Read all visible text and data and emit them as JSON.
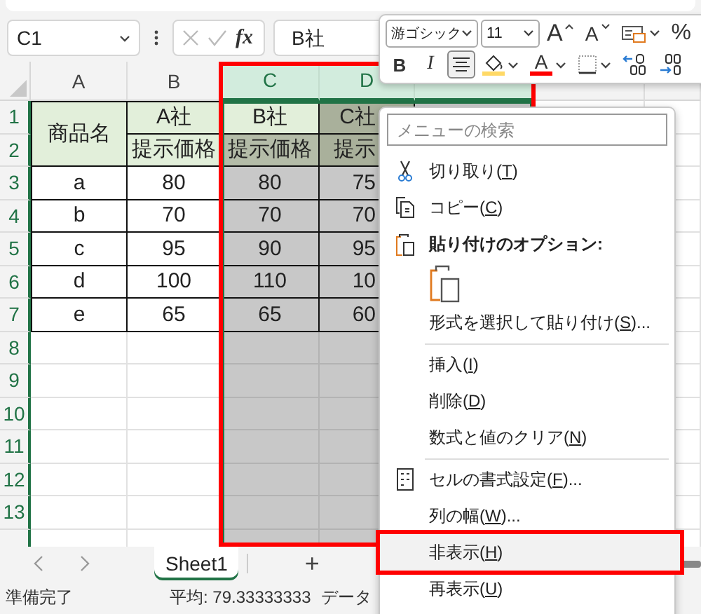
{
  "formula_bar": {
    "name_box": "C1",
    "function_label": "fx",
    "value": "B社"
  },
  "mini_toolbar": {
    "font": "游ゴシック",
    "size": "11",
    "row1": [
      {
        "kind": "grow",
        "text": "A"
      },
      {
        "kind": "shrink",
        "text": "A"
      },
      {
        "kind": "numfmt"
      },
      {
        "kind": "percent",
        "text": "%"
      }
    ],
    "row2": [
      {
        "kind": "bold",
        "text": "B",
        "selected": false
      },
      {
        "kind": "italic",
        "text": "I",
        "selected": false
      },
      {
        "kind": "align",
        "selected": true
      },
      {
        "kind": "fill",
        "color": "#ffd966"
      },
      {
        "kind": "fontcolor",
        "text": "A",
        "color": "#ff0000"
      },
      {
        "kind": "borders"
      },
      {
        "kind": "incdec"
      },
      {
        "kind": "decdec"
      }
    ]
  },
  "sheet": {
    "callout_columns": true,
    "columns": [
      {
        "label": "A",
        "selected": false
      },
      {
        "label": "B",
        "selected": false
      },
      {
        "label": "C",
        "selected": true
      },
      {
        "label": "D",
        "selected": true
      },
      {
        "selected": true
      },
      {
        "selected": false
      },
      {
        "selected": false
      }
    ],
    "rows": [
      {
        "label": "1",
        "highlighted": true,
        "kind": "header",
        "cells": [
          {
            "text": "商品名",
            "merged_down": true
          },
          {
            "text": "A社"
          },
          {
            "text": "B社",
            "active": true
          },
          {
            "text": "C社"
          }
        ]
      },
      {
        "label": "2",
        "highlighted": true,
        "kind": "header",
        "cells": [
          {
            "text": "提示価格"
          },
          {
            "text": "提示価格"
          },
          {
            "text": "提示"
          }
        ]
      },
      {
        "label": "3",
        "highlighted": true,
        "kind": "data",
        "cells": [
          {
            "text": "a"
          },
          {
            "text": "80"
          },
          {
            "text": "80"
          },
          {
            "text": "75"
          }
        ]
      },
      {
        "label": "4",
        "highlighted": true,
        "kind": "data",
        "cells": [
          {
            "text": "b"
          },
          {
            "text": "70"
          },
          {
            "text": "70"
          },
          {
            "text": "70"
          }
        ]
      },
      {
        "label": "5",
        "highlighted": true,
        "kind": "data",
        "cells": [
          {
            "text": "c"
          },
          {
            "text": "95"
          },
          {
            "text": "90"
          },
          {
            "text": "95"
          }
        ]
      },
      {
        "label": "6",
        "highlighted": true,
        "kind": "data",
        "cells": [
          {
            "text": "d"
          },
          {
            "text": "100"
          },
          {
            "text": "110"
          },
          {
            "text": "10"
          }
        ]
      },
      {
        "label": "7",
        "highlighted": true,
        "kind": "data",
        "cells": [
          {
            "text": "e"
          },
          {
            "text": "65"
          },
          {
            "text": "65"
          },
          {
            "text": "60"
          }
        ]
      },
      {
        "label": "8",
        "highlighted": true,
        "kind": "empty"
      },
      {
        "label": "9",
        "highlighted": true,
        "kind": "empty"
      },
      {
        "label": "10",
        "highlighted": true,
        "kind": "empty"
      },
      {
        "label": "11",
        "highlighted": true,
        "kind": "empty"
      },
      {
        "label": "12",
        "highlighted": true,
        "kind": "empty"
      },
      {
        "label": "13",
        "highlighted": true,
        "kind": "empty"
      },
      {
        "highlighted": true,
        "kind": "empty"
      }
    ]
  },
  "sheet_tabs": {
    "tabs": [
      {
        "label": "Sheet1",
        "selected": true
      }
    ],
    "add": "+"
  },
  "status_bar": {
    "ready": "準備完了",
    "average": "平均: 79.33333333",
    "count": "データ"
  },
  "context_menu": {
    "search_placeholder": "メニューの検索",
    "items": [
      {
        "kind": "item",
        "before": "切り取り(",
        "accel": "T",
        "after": ")",
        "hovered": false
      },
      {
        "kind": "item",
        "before": "コピー(",
        "accel": "C",
        "after": ")",
        "hovered": false
      },
      {
        "kind": "heading",
        "text": "貼り付けのオプション:"
      },
      {
        "kind": "paste_buttons"
      },
      {
        "kind": "item",
        "before": "形式を選択して貼り付け(",
        "accel": "S",
        "after": ")...",
        "hovered": false
      },
      {
        "kind": "separator"
      },
      {
        "kind": "item",
        "before": "挿入(",
        "accel": "I",
        "after": ")",
        "hovered": false
      },
      {
        "kind": "item",
        "before": "削除(",
        "accel": "D",
        "after": ")",
        "hovered": false
      },
      {
        "kind": "item",
        "before": "数式と値のクリア(",
        "accel": "N",
        "after": ")",
        "hovered": false
      },
      {
        "kind": "separator"
      },
      {
        "kind": "item",
        "before": "セルの書式設定(",
        "accel": "F",
        "after": ")...",
        "hovered": false
      },
      {
        "kind": "item",
        "before": "列の幅(",
        "accel": "W",
        "after": ")...",
        "hovered": false
      },
      {
        "kind": "item",
        "before": "非表示(",
        "accel": "H",
        "after": ")",
        "hovered": true,
        "callout": true
      },
      {
        "kind": "item",
        "before": "再表示(",
        "accel": "U",
        "after": ")",
        "hovered": false
      }
    ]
  }
}
